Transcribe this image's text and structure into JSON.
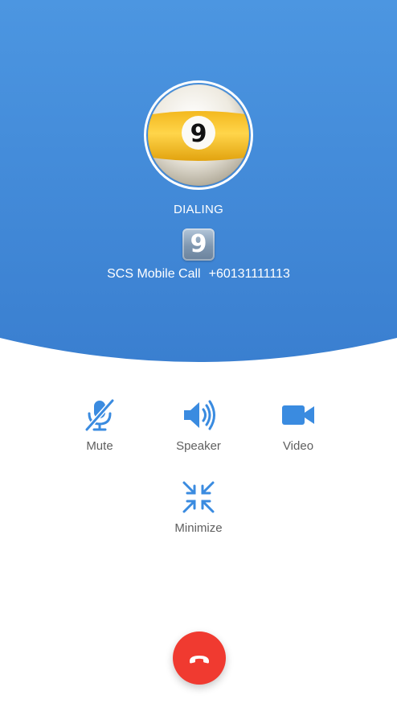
{
  "call": {
    "status": "DIALING",
    "avatar_icon": "billiard-ball-9-icon",
    "keycap": "9",
    "provider": "SCS Mobile Call",
    "number": "+60131111113"
  },
  "actions": {
    "mute": {
      "label": "Mute",
      "icon": "mic-off-icon"
    },
    "speaker": {
      "label": "Speaker",
      "icon": "speaker-icon"
    },
    "video": {
      "label": "Video",
      "icon": "video-camera-icon"
    },
    "minimize": {
      "label": "Minimize",
      "icon": "minimize-icon"
    }
  },
  "end_call": {
    "icon": "hang-up-icon"
  },
  "colors": {
    "header_gradient_top": "#4c95e0",
    "header_gradient_bottom": "#3a7fd0",
    "accent": "#3a8be0",
    "end_call": "#f03a30",
    "label": "#5f5f5f"
  }
}
